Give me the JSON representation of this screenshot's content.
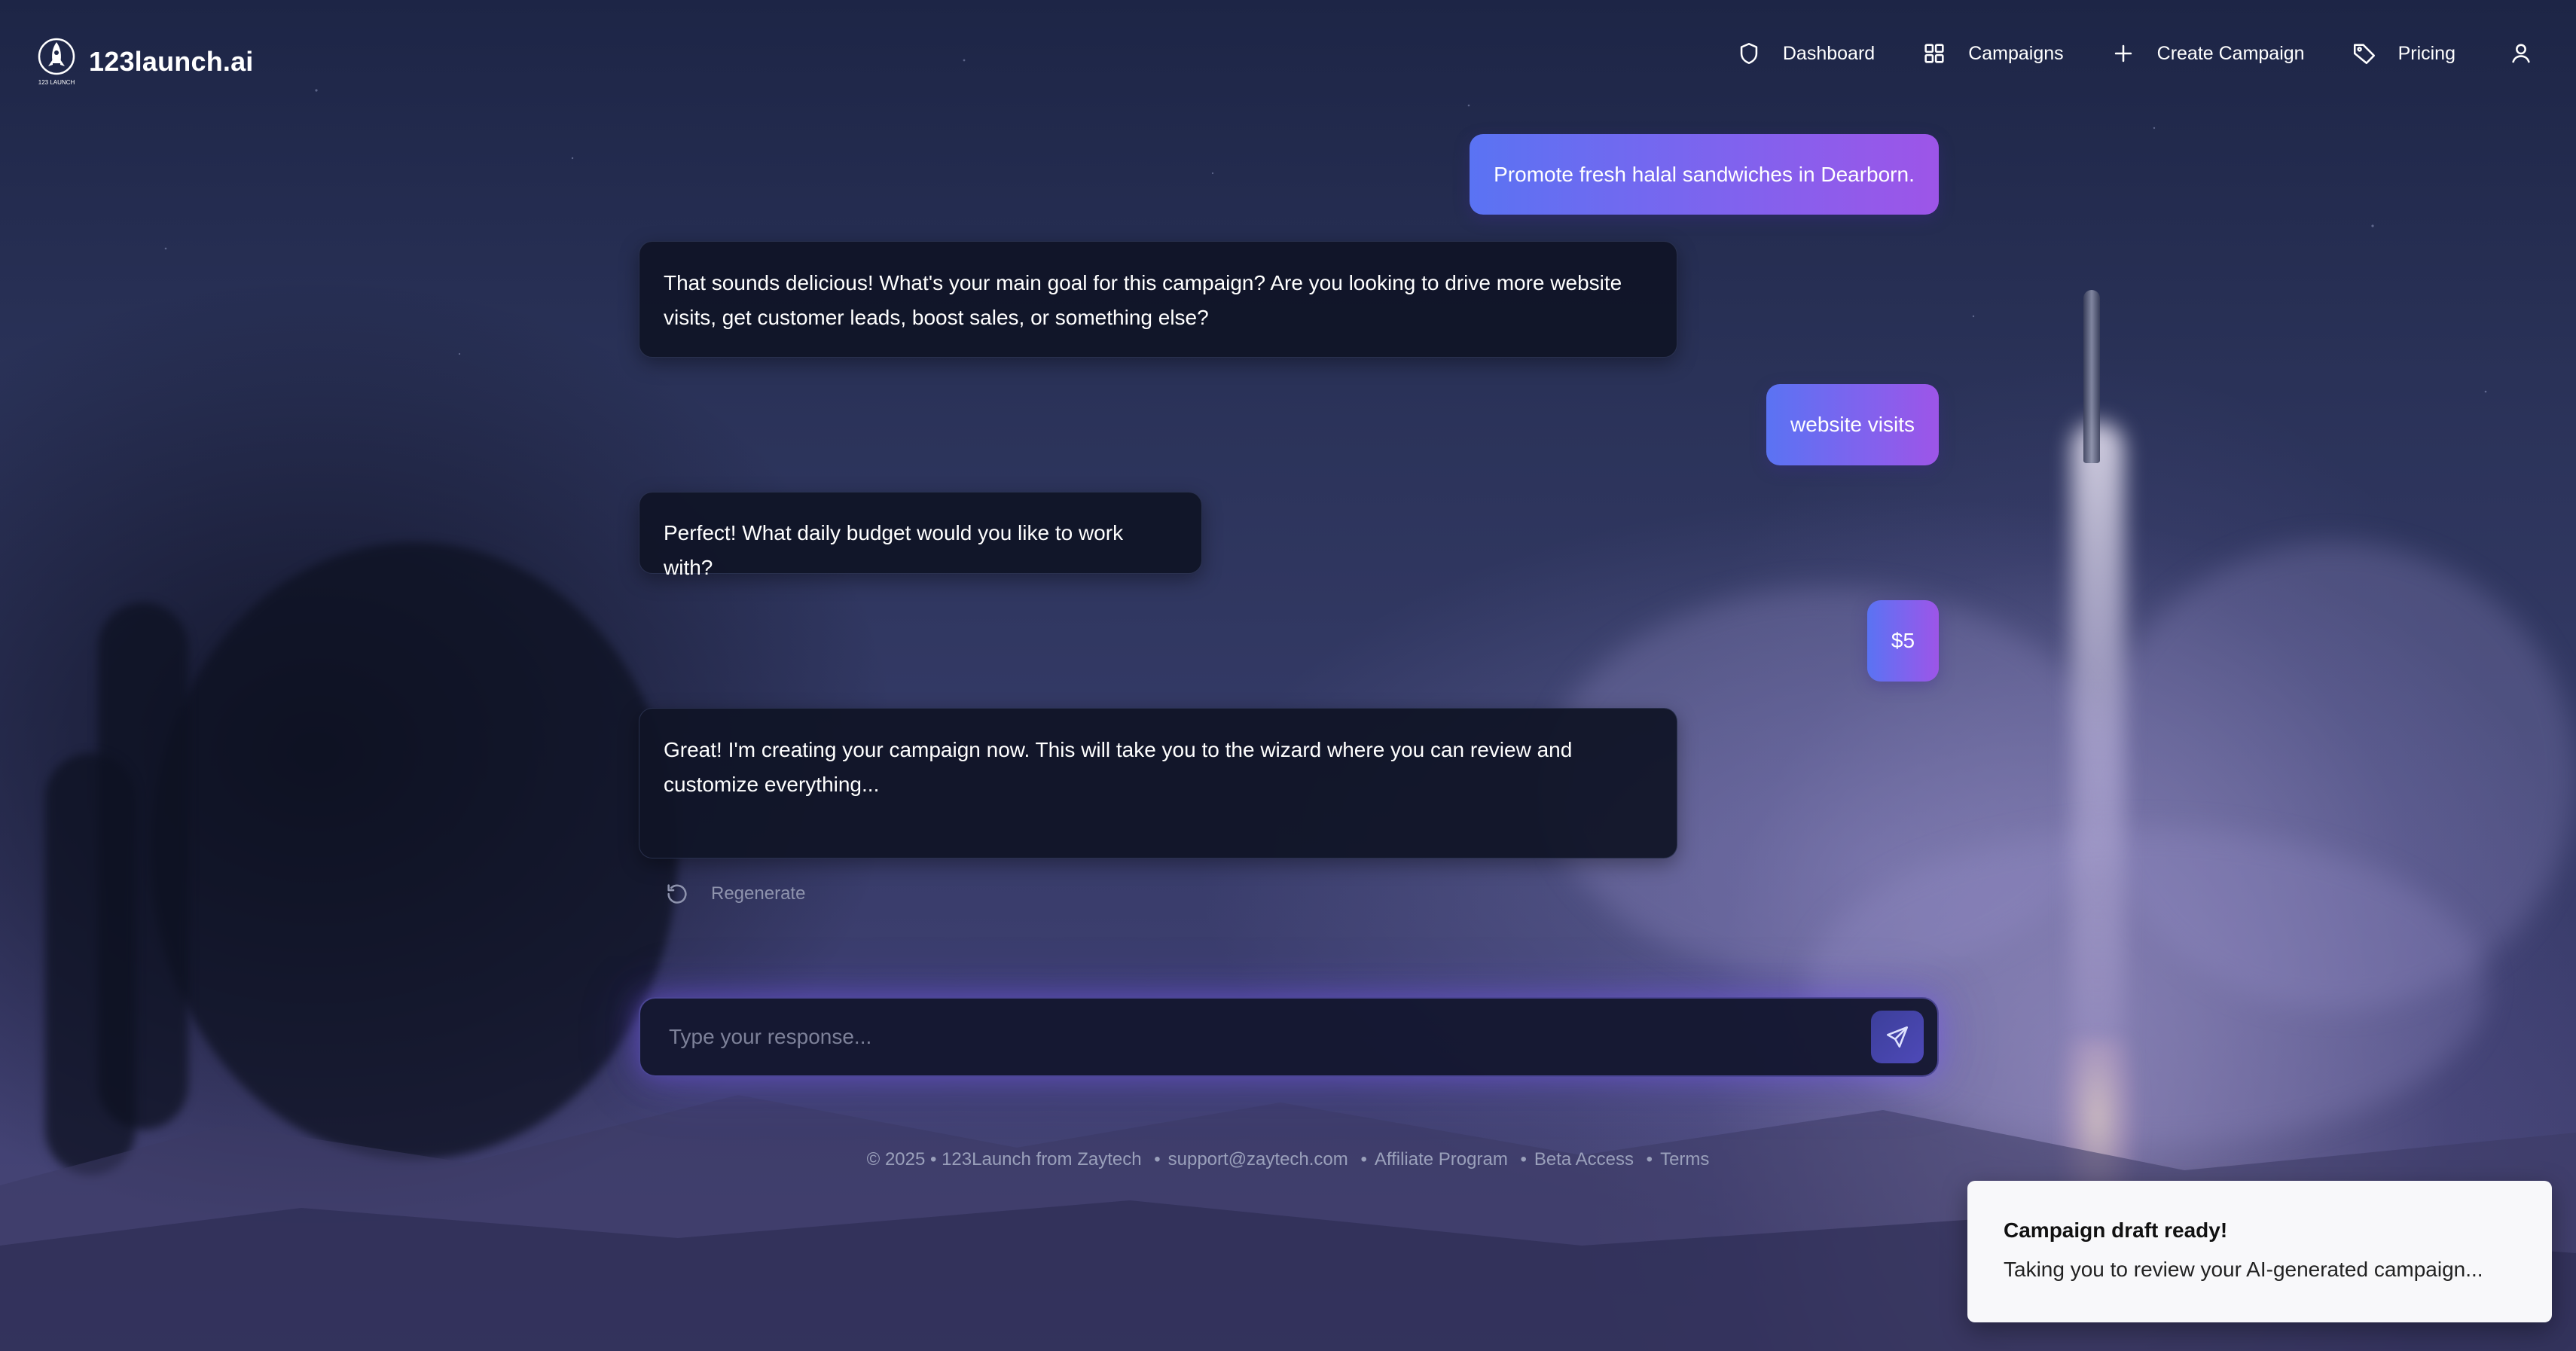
{
  "app": {
    "name": "123launch.ai",
    "logo_caption": "123 LAUNCH"
  },
  "nav": {
    "items": [
      {
        "label": "Dashboard",
        "icon": "shield-icon"
      },
      {
        "label": "Campaigns",
        "icon": "grid-icon"
      },
      {
        "label": "Create Campaign",
        "icon": "plus-icon"
      },
      {
        "label": "Pricing",
        "icon": "tag-icon"
      }
    ],
    "profile_icon": "user-icon"
  },
  "chat": {
    "messages": [
      {
        "role": "user",
        "text": "Promote fresh halal sandwiches in Dearborn."
      },
      {
        "role": "assistant",
        "text": "That sounds delicious! What's your main goal for this campaign? Are you looking to drive more website visits, get customer leads, boost sales, or something else?"
      },
      {
        "role": "user",
        "text": "website visits"
      },
      {
        "role": "assistant",
        "text": "Perfect! What daily budget would you like to work with?"
      },
      {
        "role": "user",
        "text": "$5"
      },
      {
        "role": "assistant",
        "text": "Great! I'm creating your campaign now. This will take you to the wizard where you can review and customize everything..."
      }
    ],
    "regenerate_label": "Regenerate",
    "input_placeholder": "Type your response...",
    "input_value": ""
  },
  "footer": {
    "copyright": "© 2025 • 123Launch from Zaytech",
    "links": [
      "support@zaytech.com",
      "Affiliate Program",
      "Beta Access",
      "Terms"
    ],
    "separator": "•"
  },
  "toast": {
    "title": "Campaign draft ready!",
    "description": "Taking you to review your AI-generated campaign..."
  },
  "colors": {
    "user_bubble_start": "#5a73f3",
    "user_bubble_end": "#9d55e8",
    "assistant_bubble": "#10142a",
    "accent_glow": "#7a5af0"
  }
}
